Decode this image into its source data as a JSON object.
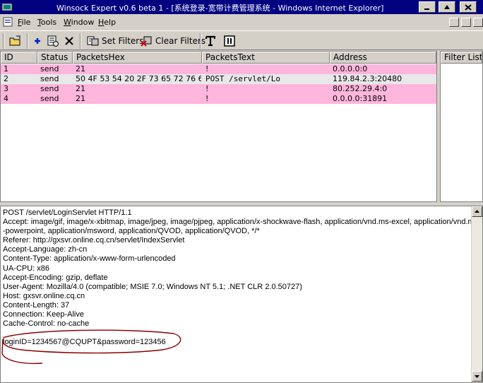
{
  "window": {
    "title": "Winsock Expert v0.6 beta 1 - [系统登录-宽带计费管理系统 - Windows Internet Explorer]"
  },
  "menu": [
    {
      "label": "File",
      "mnemonic": "F"
    },
    {
      "label": "Tools",
      "mnemonic": "T"
    },
    {
      "label": "Window",
      "mnemonic": "W"
    },
    {
      "label": "Help",
      "mnemonic": "H"
    }
  ],
  "toolbar": {
    "set_filters": "Set Filters",
    "clear_filters": "Clear Filters"
  },
  "packets": {
    "columns": [
      "ID",
      "Status",
      "PacketsHex",
      "PacketsText",
      "Address"
    ],
    "rows": [
      {
        "id": "1",
        "status": "send",
        "hex": "21",
        "text": "!",
        "address": "0.0.0.0:0",
        "highlight": true
      },
      {
        "id": "2",
        "status": "send",
        "hex": "50 4F 53 54 20 2F 73 65 72 76 6...",
        "text": "POST /servlet/Lo",
        "address": "119.84.2.3:20480",
        "highlight": false
      },
      {
        "id": "3",
        "status": "send",
        "hex": "21",
        "text": "!",
        "address": "80.252.29.4:0",
        "highlight": true
      },
      {
        "id": "4",
        "status": "send",
        "hex": "21",
        "text": "!",
        "address": "0.0.0.0:31891",
        "highlight": true
      }
    ]
  },
  "filter_list": {
    "header": "Filter List"
  },
  "packet_text": {
    "lines": [
      "POST /servlet/LoginServlet HTTP/1.1",
      "Accept: image/gif, image/x-xbitmap, image/jpeg, image/pjpeg, application/x-shockwave-flash, application/vnd.ms-excel, application/vnd.ms",
      "-powerpoint, application/msword, application/QVOD, application/QVOD, */*",
      "Referer: http://gxsvr.online.cq.cn/servlet/IndexServlet",
      "Accept-Language: zh-cn",
      "Content-Type: application/x-www-form-urlencoded",
      "UA-CPU: x86",
      "Accept-Encoding: gzip, deflate",
      "User-Agent: Mozilla/4.0 (compatible; MSIE 7.0; Windows NT 5.1; .NET CLR 2.0.50727)",
      "Host: gxsvr.online.cq.cn",
      "Content-Length: 37",
      "Connection: Keep-Alive",
      "Cache-Control: no-cache",
      "",
      "loginID=1234567@CQUPT&password=123456"
    ]
  },
  "colors": {
    "title_bar": "#000080",
    "row_highlight": "#ffb6dc",
    "row_selected": "#e8e8e8",
    "annotation": "#8b0000"
  }
}
